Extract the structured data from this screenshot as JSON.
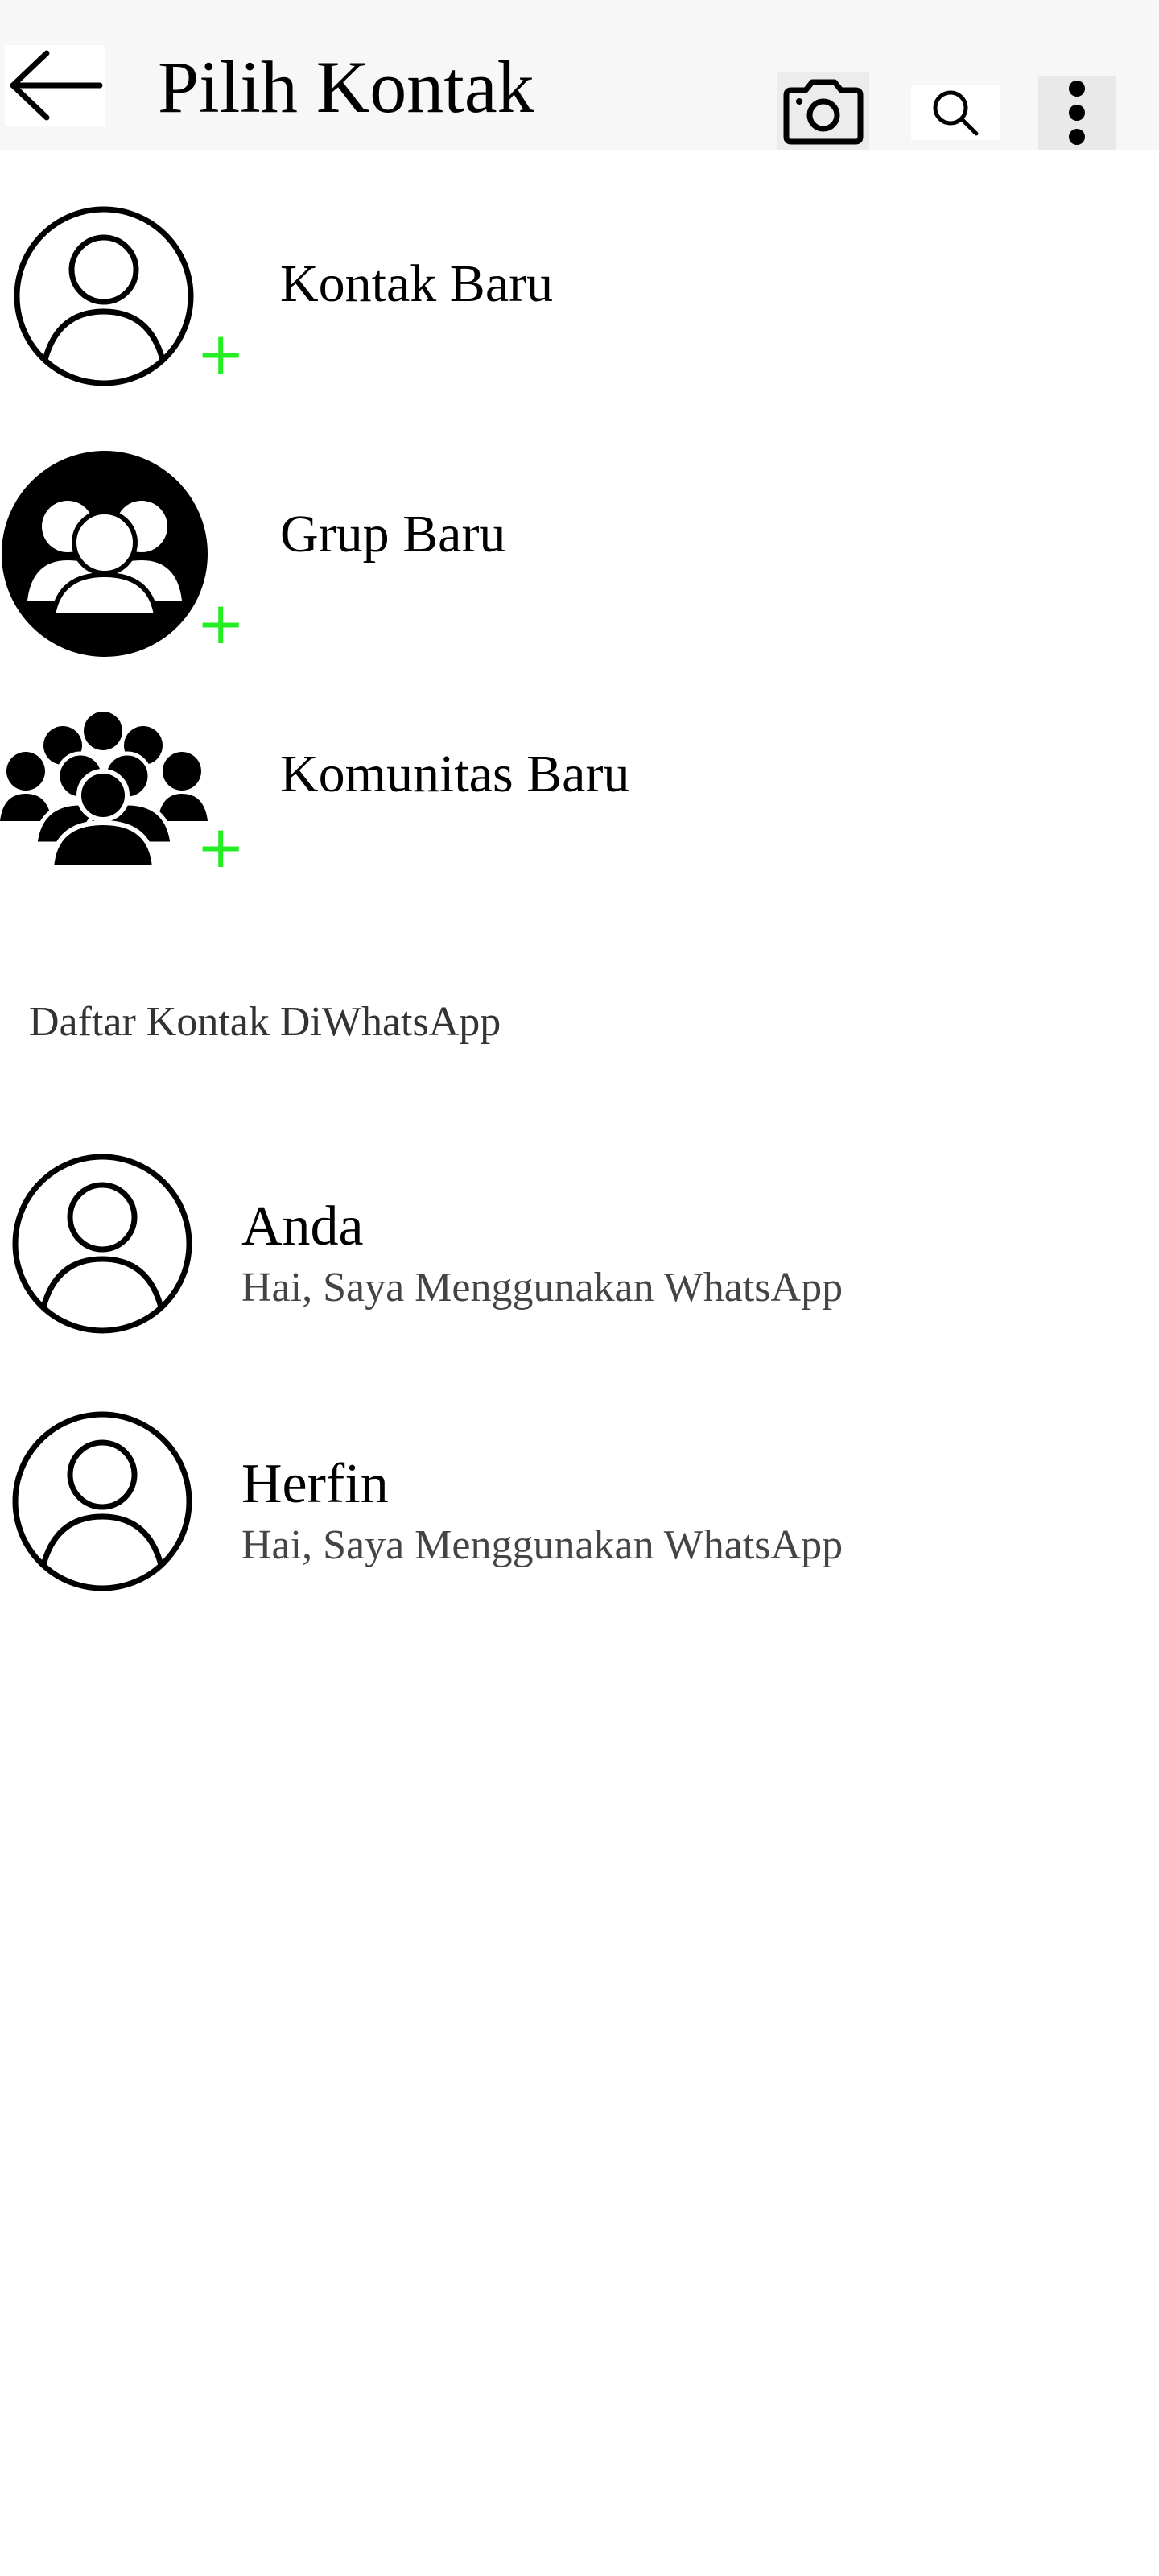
{
  "header": {
    "title": "Pilih Kontak",
    "back_icon": "arrow-left-icon",
    "camera_icon": "camera-icon",
    "search_icon": "search-icon",
    "more_icon": "more-vertical-icon"
  },
  "actions": [
    {
      "label": "Kontak Baru",
      "icon": "user-outline-icon",
      "badge": "+"
    },
    {
      "label": "Grup Baru",
      "icon": "group-icon",
      "badge": "+"
    },
    {
      "label": "Komunitas Baru",
      "icon": "community-icon",
      "badge": "+"
    }
  ],
  "section": {
    "title": "Daftar Kontak DiWhatsApp"
  },
  "contacts": [
    {
      "name": "Anda",
      "status": "Hai, Saya Menggunakan WhatsApp"
    },
    {
      "name": "Herfin",
      "status": "Hai, Saya Menggunakan WhatsApp"
    }
  ],
  "colors": {
    "accent_plus": "#22ee22",
    "header_bg": "#f7f7f7"
  }
}
